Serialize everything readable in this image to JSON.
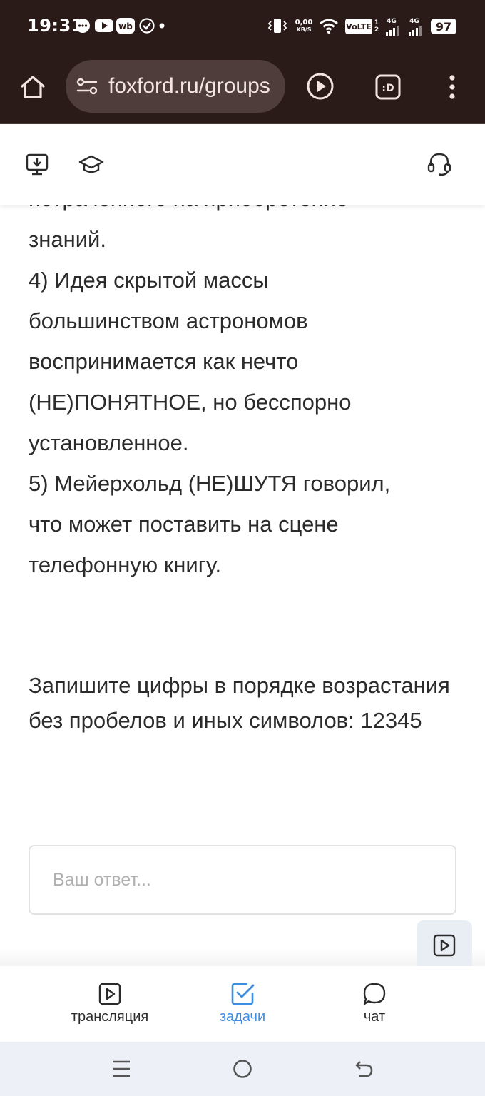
{
  "status_bar": {
    "time": "19:31",
    "net_speed_value": "0,00",
    "net_speed_unit": "KB/S",
    "volte": "VoLTE",
    "sim1": "1",
    "sim2": "2",
    "net1": "4G",
    "net2": "4G",
    "battery": "97"
  },
  "browser": {
    "url": "foxford.ru/groups"
  },
  "task": {
    "lines": [
      "потраченного на приобретение",
      "знаний.",
      "4) Идея скрытой массы",
      "большинством астрономов",
      "воспринимается как нечто",
      "(НЕ)ПОНЯТНОЕ, но бесспорно",
      "установленное.",
      "5) Мейерхольд (НЕ)ШУТЯ говорил,",
      "что может поставить на сцене",
      "телефонную книгу."
    ],
    "instruction": "Запишите цифры в порядке возрастания без пробелов и иных символов: 12345",
    "answer_placeholder": "Ваш ответ..."
  },
  "tabs": [
    {
      "label": "трансляция",
      "icon": "play-square-icon"
    },
    {
      "label": "задачи",
      "icon": "check-square-icon"
    },
    {
      "label": "чат",
      "icon": "chat-bubble-icon"
    }
  ],
  "colors": {
    "status_bg": "#2a1a18",
    "url_pill": "#4e3d3a",
    "accent_active": "#3d8de0",
    "nav_bg": "#eef0f7"
  }
}
